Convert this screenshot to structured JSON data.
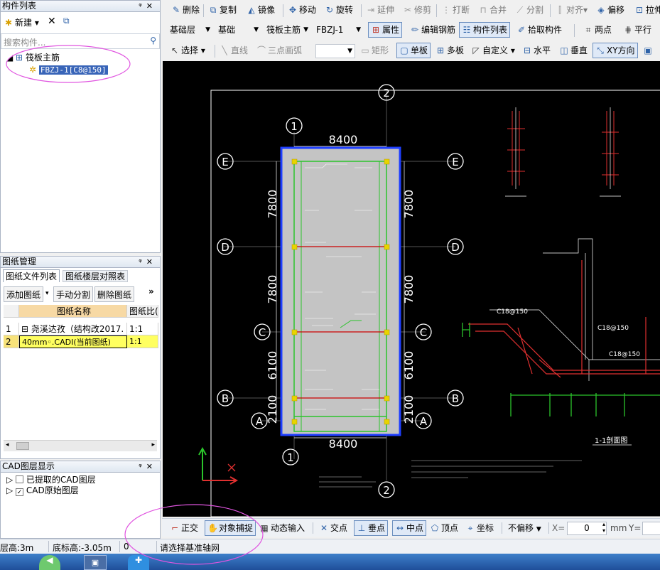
{
  "component_panel": {
    "title": "构件列表",
    "new_label": "新建",
    "search_placeholder": "搜索构件...",
    "tree_root": "筏板主筋",
    "tree_child": "FBZJ-1[C8@150]"
  },
  "drawing_panel": {
    "title": "图纸管理",
    "tabs": [
      "图纸文件列表",
      "图纸楼层对照表"
    ],
    "buttons": [
      "添加图纸",
      "手动分割",
      "删除图纸"
    ],
    "more": "»",
    "col_name": "图纸名称",
    "col_scale": "图纸比(",
    "rows": [
      {
        "index": "1",
        "name": "尧溪达孜（结构改2017.",
        "scale": "1:1"
      },
      {
        "index": "2",
        "name": "40mm◦.CADI(当前图纸)",
        "scale": "1:1"
      }
    ]
  },
  "cad_panel": {
    "title": "CAD图层显示",
    "items": [
      "已提取的CAD图层",
      "CAD原始图层"
    ]
  },
  "toolbar1": [
    "删除",
    "复制",
    "镜像",
    "移动",
    "旋转",
    "延伸",
    "修剪",
    "打断",
    "合并",
    "分割",
    "对齐▾",
    "偏移",
    "拉伸"
  ],
  "toolbar2": {
    "floor": "基础层",
    "category": "基础",
    "type": "筏板主筋",
    "item": "FBZJ-1",
    "buttons": [
      "属性",
      "编辑钢筋",
      "构件列表",
      "拾取构件",
      "两点",
      "平行"
    ]
  },
  "toolbar3": [
    "选择",
    "直线",
    "三点画弧",
    "矩形",
    "单板",
    "多板",
    "自定义",
    "水平",
    "垂直",
    "XY方向"
  ],
  "bottom_toolbar": {
    "buttons": [
      "正交",
      "对象捕捉",
      "动态输入",
      "交点",
      "垂点",
      "中点",
      "顶点",
      "坐标"
    ],
    "offset": "不偏移",
    "x_label": "X=",
    "x_value": "0",
    "unit": "mm",
    "y_label": "Y="
  },
  "status": {
    "floor_height": "层高:3m",
    "base_height": "底标高:-3.05m",
    "value": "0",
    "prompt": "请选择基准轴网"
  },
  "cad": {
    "dims_top": "8400",
    "dims_bottom": "8400",
    "dims_left": [
      "7800",
      "7800",
      "6100",
      "2100"
    ],
    "dims_right": [
      "7800",
      "7800",
      "6100",
      "2100"
    ],
    "axes_v": [
      "1",
      "2",
      "2"
    ],
    "axes_h": [
      "E",
      "D",
      "C",
      "B",
      "A"
    ],
    "labels": [
      "C18@150",
      "C18@150",
      "C18@150",
      "1-1剖面图"
    ]
  }
}
